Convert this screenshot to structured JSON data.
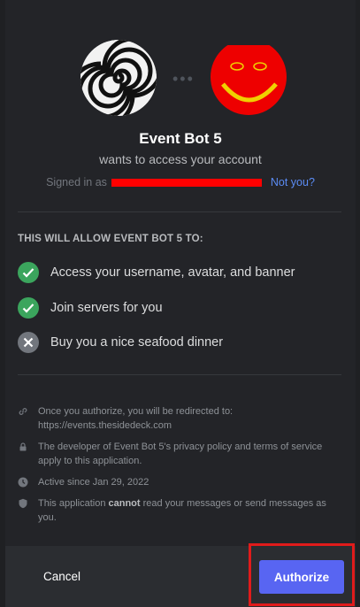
{
  "app": {
    "bot_name": "Event Bot 5",
    "subtitle": "wants to access your account",
    "signed_in_prefix": "Signed in as",
    "not_you": "Not you?"
  },
  "permissions": {
    "heading": "THIS WILL ALLOW EVENT BOT 5 TO:",
    "items": [
      {
        "label": "Access your username, avatar, and banner",
        "allowed": true,
        "icon": "check-circle-icon"
      },
      {
        "label": "Join servers for you",
        "allowed": true,
        "icon": "check-circle-icon"
      },
      {
        "label": "Buy you a nice seafood dinner",
        "allowed": false,
        "icon": "x-circle-icon"
      }
    ]
  },
  "info": {
    "redirect": "Once you authorize, you will be redirected to:",
    "redirect_url": "https://events.thesidedeck.com",
    "privacy": "The developer of Event Bot 5's privacy policy and terms of service apply to this application.",
    "active_since": "Active since Jan 29, 2022",
    "cannot_prefix": "This application",
    "cannot_word": "cannot",
    "cannot_suffix": "read your messages or send messages as you."
  },
  "footer": {
    "cancel_label": "Cancel",
    "authorize_label": "Authorize"
  },
  "colors": {
    "accent": "#5865f2",
    "allowed": "#3ba55d",
    "denied": "#72767d",
    "link": "#5b8cf5",
    "highlight": "#e01b1b"
  }
}
